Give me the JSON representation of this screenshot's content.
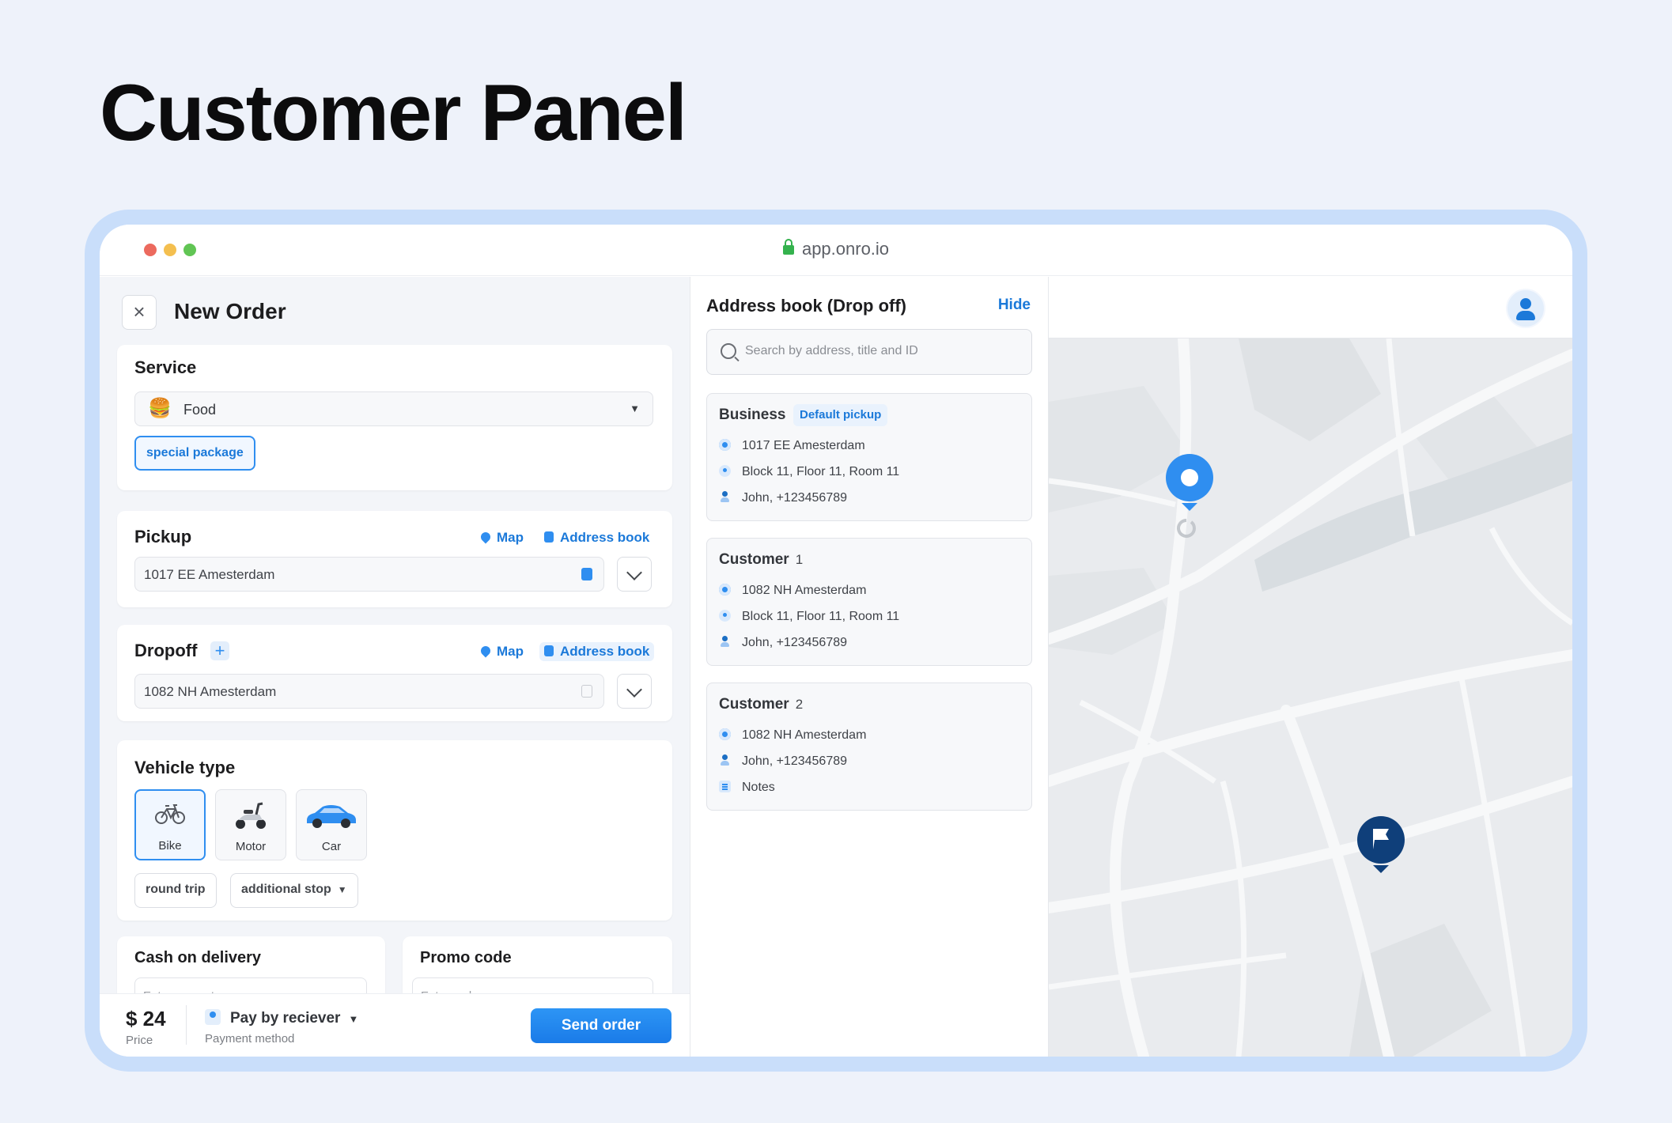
{
  "hero": {
    "title": "Customer Panel"
  },
  "browser": {
    "url": "app.onro.io"
  },
  "order": {
    "title": "New Order",
    "service": {
      "title": "Service",
      "selected": "Food",
      "selected_icon": "hamburger-icon",
      "option_chip": "special package"
    },
    "pickup": {
      "title": "Pickup",
      "map_link": "Map",
      "address_book_link": "Address book",
      "value": "1017 EE Amesterdam"
    },
    "dropoff": {
      "title": "Dropoff",
      "map_link": "Map",
      "address_book_link": "Address book",
      "value": "1082 NH Amesterdam"
    },
    "vehicle": {
      "title": "Vehicle type",
      "options": [
        "Bike",
        "Motor",
        "Car"
      ],
      "selected": "Bike",
      "chips": {
        "round_trip": "round trip",
        "additional_stop": "additional stop"
      }
    },
    "cod": {
      "title": "Cash on delivery",
      "placeholder": "Enter amount"
    },
    "promo": {
      "title": "Promo code",
      "placeholder": "Enter code"
    },
    "footer": {
      "price": "$ 24",
      "price_label": "Price",
      "payment": "Pay by reciever",
      "payment_label": "Payment method",
      "send": "Send order"
    }
  },
  "address_book": {
    "title": "Address book (Drop off)",
    "hide": "Hide",
    "search_placeholder": "Search by address, title and ID",
    "cards": [
      {
        "title": "Business",
        "tag": "Default pickup",
        "address": "1017 EE Amesterdam",
        "detail": "Block 11, Floor 11, Room 11",
        "contact": "John, +123456789"
      },
      {
        "title": "Customer",
        "num": "1",
        "address": "1082 NH Amesterdam",
        "detail": "Block 11, Floor 11, Room 11",
        "contact": "John, +123456789"
      },
      {
        "title": "Customer",
        "num": "2",
        "address": "1082 NH Amesterdam",
        "contact": "John, +123456789",
        "notes": "Notes"
      }
    ]
  },
  "colors": {
    "accent": "#1b79d9",
    "pickup_pin": "#2f8ef0",
    "dropoff_pin": "#0f3f7a"
  }
}
